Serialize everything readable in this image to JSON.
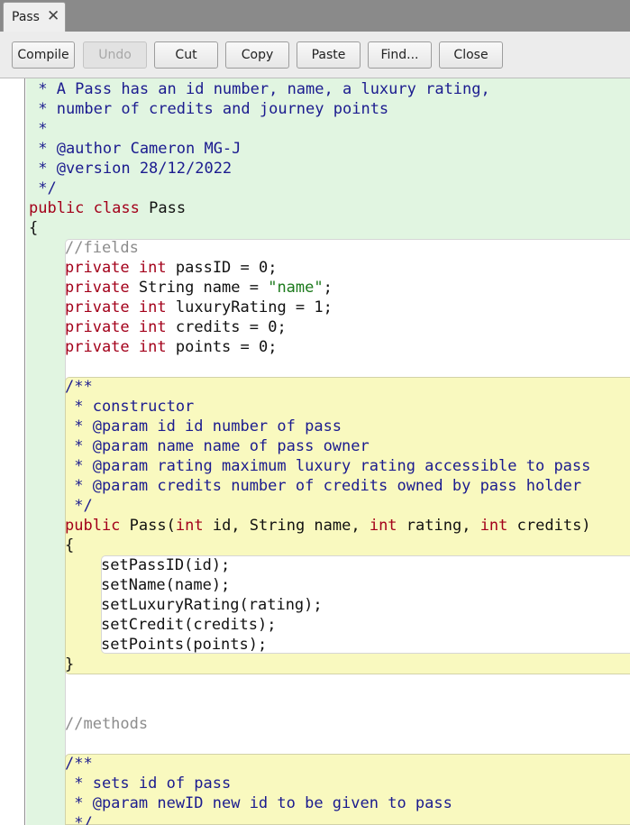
{
  "tab": {
    "label": "Pass",
    "close_icon": "close-icon"
  },
  "toolbar": {
    "compile": "Compile",
    "undo": "Undo",
    "cut": "Cut",
    "copy": "Copy",
    "paste": "Paste",
    "find": "Find...",
    "close": "Close"
  },
  "code": {
    "l1": " * A Pass has an id number, name, a luxury rating,",
    "l2": " * number of credits and journey points",
    "l3": " *",
    "l4": " * @author Cameron MG-J",
    "l5": " * @version 28/12/2022",
    "l6": " */",
    "l7_kw1": "public",
    "l7_kw2": "class",
    "l7_name": "Pass",
    "l8": "{",
    "l9": "//fields",
    "f1_a": "private",
    "f1_b": "int",
    "f1_c": "passID = 0;",
    "f2_a": "private",
    "f2_b": "String name = ",
    "f2_str": "\"name\"",
    "f2_c": ";",
    "f3_a": "private",
    "f3_b": "int",
    "f3_c": "luxuryRating = 1;",
    "f4_a": "private",
    "f4_b": "int",
    "f4_c": "credits = 0;",
    "f5_a": "private",
    "f5_b": "int",
    "f5_c": "points = 0;",
    "c1": "/**",
    "c2": " * constructor",
    "c3": " * @param id id number of pass",
    "c4": " * @param name name of pass owner",
    "c5": " * @param rating maximum luxury rating accessible to pass",
    "c6": " * @param credits number of credits owned by pass holder",
    "c7": " */",
    "sig_public": "public",
    "sig_a": "Pass(",
    "sig_int1": "int",
    "sig_b": "id, String name, ",
    "sig_int2": "int",
    "sig_c": "rating, ",
    "sig_int3": "int",
    "sig_d": "credits)",
    "ob": "{",
    "b1": "setPassID(id);",
    "b2": "setName(name);",
    "b3": "setLuxuryRating(rating);",
    "b4": "setCredit(credits);",
    "b5": "setPoints(points);",
    "cb": "}",
    "methods": "//methods",
    "m1": "/**",
    "m2": " * sets id of pass",
    "m3": " * @param newID new id to be given to pass",
    "m4": " */"
  },
  "colors": {
    "class_scope": "#e1f5e1",
    "method_scope": "#f9f9bf",
    "keyword": "#a3001a",
    "comment": "#1b1b8f",
    "string": "#1c7a1c"
  }
}
